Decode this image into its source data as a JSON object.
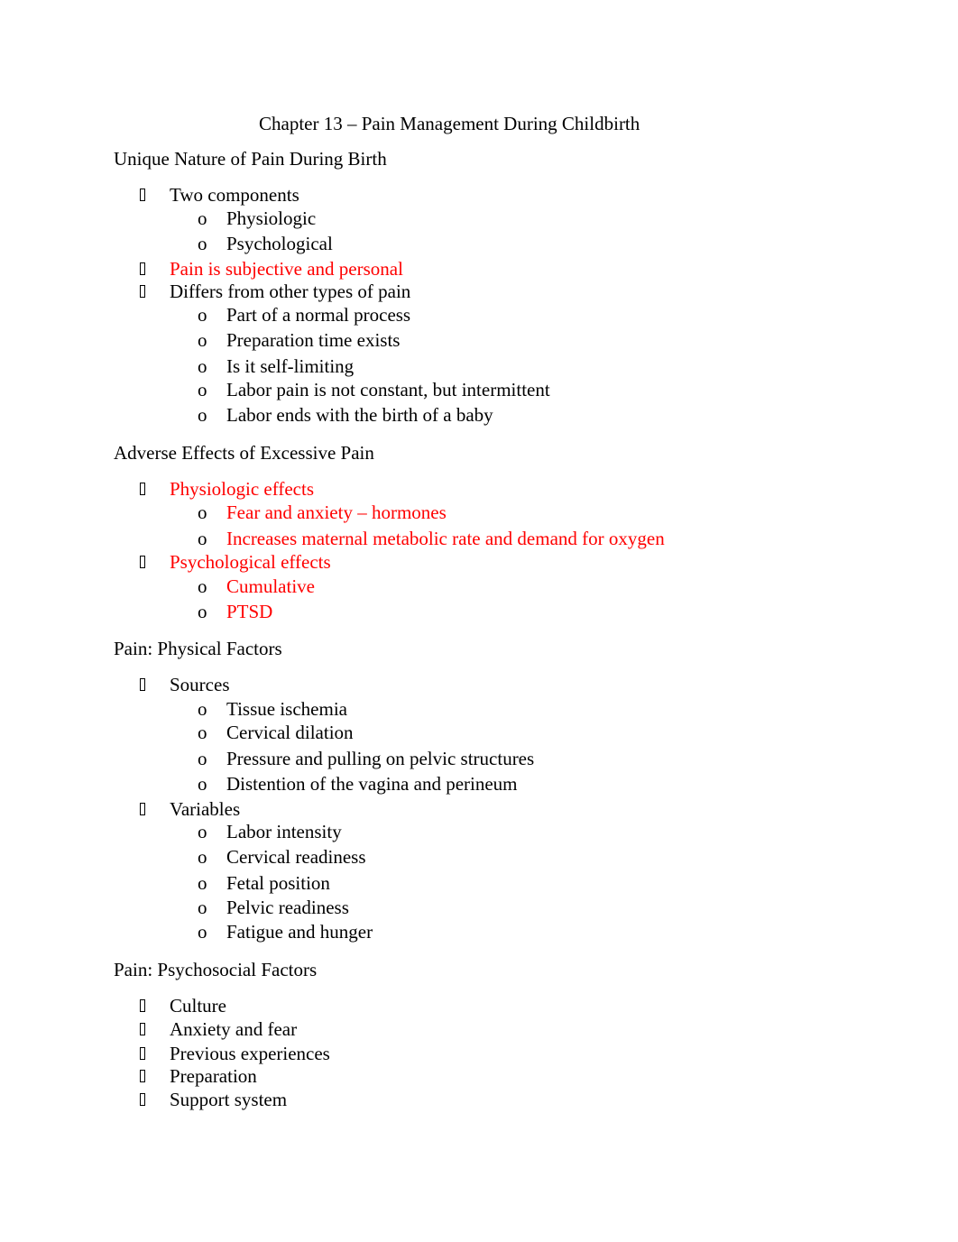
{
  "document": {
    "title": "Chapter 13 – Pain Management During Childbirth",
    "sub_marker": "o",
    "colors": {
      "text": "#000000",
      "highlight": "#ff0000"
    },
    "sections": [
      {
        "heading": "Unique Nature of Pain During Birth",
        "items": [
          {
            "text": "Two components",
            "red": false,
            "children": [
              {
                "text": "Physiologic",
                "red": false
              },
              {
                "text": "Psychological",
                "red": false
              }
            ]
          },
          {
            "text": "Pain is subjective and personal",
            "red": true,
            "children": []
          },
          {
            "text": "Differs from other types of pain",
            "red": false,
            "children": [
              {
                "text": "Part of a normal process",
                "red": false
              },
              {
                "text": "Preparation time exists",
                "red": false
              },
              {
                "text": "Is it self-limiting",
                "red": false
              },
              {
                "text": "Labor pain is not constant, but intermittent",
                "red": false
              },
              {
                "text": "Labor ends with the birth of a baby",
                "red": false
              }
            ]
          }
        ]
      },
      {
        "heading": "Adverse Effects of Excessive Pain",
        "items": [
          {
            "text": "Physiologic effects",
            "red": true,
            "children": [
              {
                "text": "Fear and anxiety – hormones",
                "red": true
              },
              {
                "text": "Increases maternal metabolic rate and demand for oxygen",
                "red": true
              }
            ]
          },
          {
            "text": "Psychological effects",
            "red": true,
            "children": [
              {
                "text": "Cumulative",
                "red": true
              },
              {
                "text": "PTSD",
                "red": true
              }
            ]
          }
        ]
      },
      {
        "heading": "Pain: Physical Factors",
        "items": [
          {
            "text": "Sources",
            "red": false,
            "children": [
              {
                "text": "Tissue ischemia",
                "red": false
              },
              {
                "text": "Cervical dilation",
                "red": false
              },
              {
                "text": "Pressure and pulling on pelvic structures",
                "red": false
              },
              {
                "text": "Distention of the vagina and perineum",
                "red": false
              }
            ]
          },
          {
            "text": "Variables",
            "red": false,
            "children": [
              {
                "text": "Labor intensity",
                "red": false
              },
              {
                "text": "Cervical readiness",
                "red": false
              },
              {
                "text": "Fetal position",
                "red": false
              },
              {
                "text": "Pelvic readiness",
                "red": false
              },
              {
                "text": "Fatigue and hunger",
                "red": false
              }
            ]
          }
        ]
      },
      {
        "heading": "Pain: Psychosocial Factors",
        "items": [
          {
            "text": "Culture",
            "red": false,
            "children": []
          },
          {
            "text": "Anxiety and fear",
            "red": false,
            "children": []
          },
          {
            "text": "Previous experiences",
            "red": false,
            "children": []
          },
          {
            "text": "Preparation",
            "red": false,
            "children": []
          },
          {
            "text": "Support system",
            "red": false,
            "children": []
          }
        ]
      }
    ]
  }
}
